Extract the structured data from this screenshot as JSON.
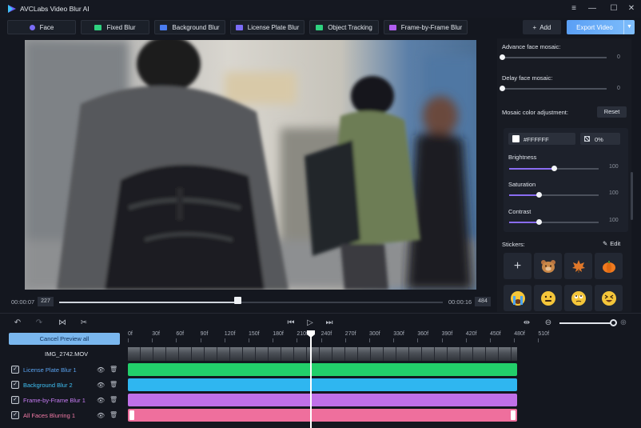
{
  "app": {
    "title": "AVCLabs Video Blur AI"
  },
  "window": {
    "minimize": "—",
    "maximize": "☐",
    "close": "✕",
    "menu": "≡"
  },
  "toolbar": {
    "tabs": [
      {
        "label": "Face",
        "icon": "face-icon",
        "color": "#7b6cf6"
      },
      {
        "label": "Fixed Blur",
        "icon": "fixed-blur-icon",
        "color": "#2fd17f"
      },
      {
        "label": "Background Blur",
        "icon": "background-blur-icon",
        "color": "#4a7cf0"
      },
      {
        "label": "License Plate Blur",
        "icon": "license-plate-icon",
        "color": "#7b6cf6"
      },
      {
        "label": "Object Tracking",
        "icon": "object-tracking-icon",
        "color": "#2fd17f"
      },
      {
        "label": "Frame-by-Frame Blur",
        "icon": "frame-by-frame-icon",
        "color": "#b05ef0"
      }
    ],
    "add_label": "Add",
    "export_label": "Export Video"
  },
  "player": {
    "time_current": "00:00:07",
    "frame_current": "227",
    "time_total": "00:00:16",
    "frame_total": "484",
    "progress_fraction": 0.469
  },
  "panel": {
    "advance_face_mosaic": {
      "label": "Advance face mosaic:",
      "value": "0"
    },
    "delay_face_mosaic": {
      "label": "Delay face mosaic:",
      "value": "0"
    },
    "mosaic_color": {
      "label": "Mosaic color adjustment:",
      "reset_label": "Reset",
      "hex": "#FFFFFF",
      "opacity": "0%",
      "brightness": {
        "label": "Brightness",
        "value": "100",
        "fraction": 0.5
      },
      "saturation": {
        "label": "Saturation",
        "value": "100",
        "fraction": 0.33
      },
      "contrast": {
        "label": "Contrast",
        "value": "100",
        "fraction": 0.33
      }
    },
    "stickers": {
      "label": "Stickers:",
      "edit_label": "Edit",
      "add_symbol": "+",
      "items": [
        "bear",
        "maple-leaf",
        "pumpkin",
        "crying-face",
        "grimacing-face",
        "rolling-eyes-face",
        "squinting-face"
      ]
    }
  },
  "timeline": {
    "cancel_preview_label": "Cancel Preview all",
    "ruler_labels": [
      "0f",
      "30f",
      "60f",
      "90f",
      "120f",
      "150f",
      "180f",
      "210f",
      "240f",
      "270f",
      "300f",
      "330f",
      "360f",
      "390f",
      "420f",
      "450f",
      "480f",
      "510f"
    ],
    "video_file": "IMG_2742.MOV",
    "tracks": [
      {
        "name": "License Plate Blur 1",
        "color": "#22cf6a",
        "name_color": "#5aa3f0"
      },
      {
        "name": "Background Blur 2",
        "color": "#2fb6f0",
        "name_color": "#3fc1f5"
      },
      {
        "name": "Frame-by-Frame Blur 1",
        "color": "#c070e8",
        "name_color": "#c77cf5"
      },
      {
        "name": "All Faces Blurring 1",
        "color": "#ef6f9d",
        "name_color": "#f27aa6"
      }
    ],
    "playhead_frame": "227"
  }
}
